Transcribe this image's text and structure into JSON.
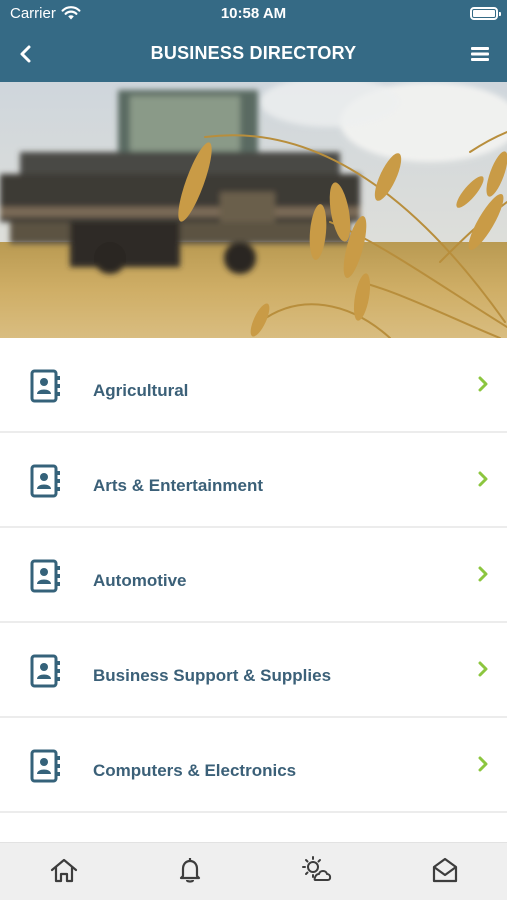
{
  "status_bar": {
    "carrier": "Carrier",
    "time": "10:58 AM"
  },
  "header": {
    "title": "BUSINESS DIRECTORY"
  },
  "hero": {
    "description_icon": "wheat-field-photo"
  },
  "categories": [
    {
      "label": "Agricultural",
      "icon": "address-book-icon"
    },
    {
      "label": "Arts & Entertainment",
      "icon": "address-book-icon"
    },
    {
      "label": "Automotive",
      "icon": "address-book-icon"
    },
    {
      "label": "Business Support & Supplies",
      "icon": "address-book-icon"
    },
    {
      "label": "Computers & Electronics",
      "icon": "address-book-icon"
    }
  ],
  "tabbar": {
    "items": [
      "home-icon",
      "bell-icon",
      "weather-icon",
      "mail-icon"
    ]
  },
  "colors": {
    "header": "#356a85",
    "label": "#3b6078",
    "chevron": "#8cc63f",
    "tabbar": "#efefef"
  }
}
